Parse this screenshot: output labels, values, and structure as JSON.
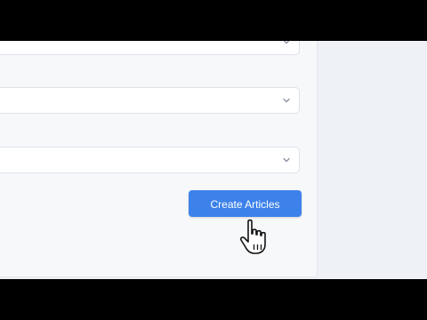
{
  "form": {
    "selects": [
      {
        "value": ""
      },
      {
        "value": ""
      },
      {
        "value": ""
      }
    ],
    "submit_label": "Create Articles"
  },
  "icons": {
    "select_chevron": "chevron-down-icon",
    "cursor": "hand-pointer-cursor"
  },
  "colors": {
    "primary_button": "#3d82ea",
    "panel_bg": "#f6f8fa",
    "page_bg": "#eef1f5",
    "letterbox": "#000000"
  }
}
